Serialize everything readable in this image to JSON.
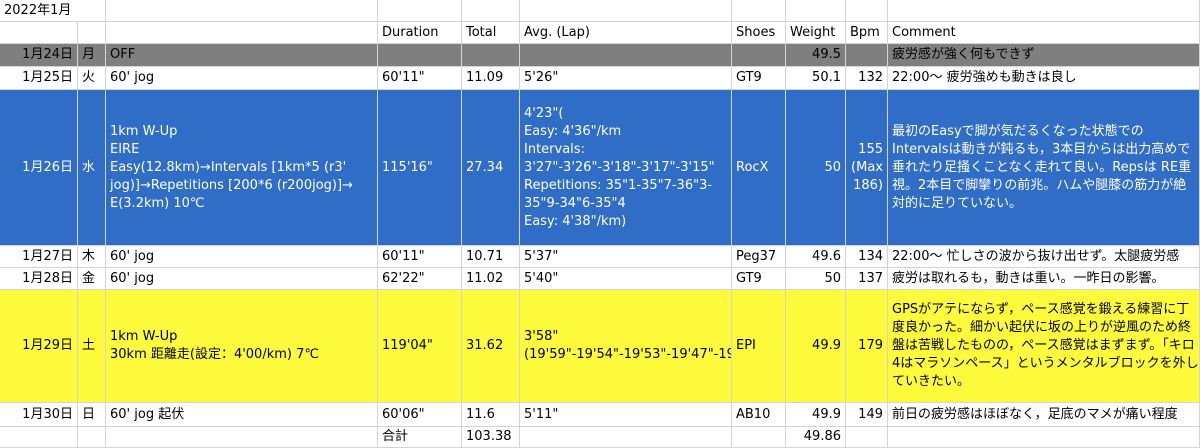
{
  "title": "2022年1月",
  "headers": {
    "duration": "Duration",
    "total": "Total",
    "avg": "Avg. (Lap)",
    "shoes": "Shoes",
    "weight": "Weight",
    "bpm": "Bpm",
    "comment": "Comment"
  },
  "rows": [
    {
      "style": "off",
      "date": "1月24日",
      "dow": "月",
      "menu": "OFF",
      "duration": "",
      "total": "",
      "avg": "",
      "shoes": "",
      "weight": "49.5",
      "bpm": "",
      "comment": "疲労感が強く何もできず"
    },
    {
      "style": "plain",
      "date": "1月25日",
      "dow": "火",
      "menu": "60' jog",
      "duration": "60'11\"",
      "total": "11.09",
      "avg": "5'26\"",
      "shoes": "GT9",
      "weight": "50.1",
      "bpm": "132",
      "comment": "22:00～ 疲労強めも動きは良し"
    },
    {
      "style": "blue",
      "date": "1月26日",
      "dow": "水",
      "menu": "1km W-Up\nEIRE\nEasy(12.8km)→Intervals [1km*5 (r3' jog)]→Repetitions [200*6 (r200jog)]→ E(3.2km) 10℃",
      "duration": "115'16\"",
      "total": "27.34",
      "avg": "4'23\"(\nEasy: 4'36\"/km\nIntervals: 3'27\"-3'26\"-3'18\"-3'17\"-3'15\"\nRepetitions: 35\"1-35\"7-36\"3-35\"9-34\"6-35\"4\nEasy: 4'38\"/km)",
      "shoes": "RocX",
      "weight": "50",
      "bpm": "155 (Max 186)",
      "comment": "最初のEasyで脚が気だるくなった状態でのIntervalsは動きが鈍るも，3本目からは出力高めで垂れたり足掻くことなく走れて良い。Repsは RE重視。2本目で脚攣りの前兆。ハムや腿膝の筋力が絶対的に足りていない。"
    },
    {
      "style": "plain",
      "date": "1月27日",
      "dow": "木",
      "menu": "60' jog",
      "duration": "60'11\"",
      "total": "10.71",
      "avg": "5'37\"",
      "shoes": "Peg37",
      "weight": "49.6",
      "bpm": "134",
      "comment": "22:00～ 忙しさの波から抜け出せず。太腿疲労感"
    },
    {
      "style": "plain",
      "date": "1月28日",
      "dow": "金",
      "menu": "60' jog",
      "duration": "62'22\"",
      "total": "11.02",
      "avg": "5'40\"",
      "shoes": "GT9",
      "weight": "50",
      "bpm": "137",
      "comment": "疲労は取れるも，動きは重い。一昨日の影響。"
    },
    {
      "style": "yellow",
      "date": "1月29日",
      "dow": "土",
      "menu": "1km W-Up\n30km 距離走(設定：4'00/km) 7℃",
      "duration": "119'04\"",
      "total": "31.62",
      "avg": "3'58\"(19'59\"-19'54\"-19'53\"-19'47\"-19'43\"-19'46\")",
      "shoes": "EPI",
      "weight": "49.9",
      "bpm": "179",
      "comment": "GPSがアテにならず，ペース感覚を鍛える練習に丁度良かった。細かい起伏に坂の上りが逆風のため終盤は苦戦したものの，ペース感覚はまずまず。「キロ4はマラソンペース」というメンタルブロックを外していきたい。"
    },
    {
      "style": "plain",
      "date": "1月30日",
      "dow": "日",
      "menu": "60' jog 起伏",
      "duration": "60'06\"",
      "total": "11.6",
      "avg": "5'11\"",
      "shoes": "AB10",
      "weight": "49.9",
      "bpm": "149",
      "comment": "前日の疲労感はほぼなく，足底のマメが痛い程度"
    }
  ],
  "summary": {
    "label": "合計",
    "total": "103.38",
    "weight": "49.86"
  }
}
